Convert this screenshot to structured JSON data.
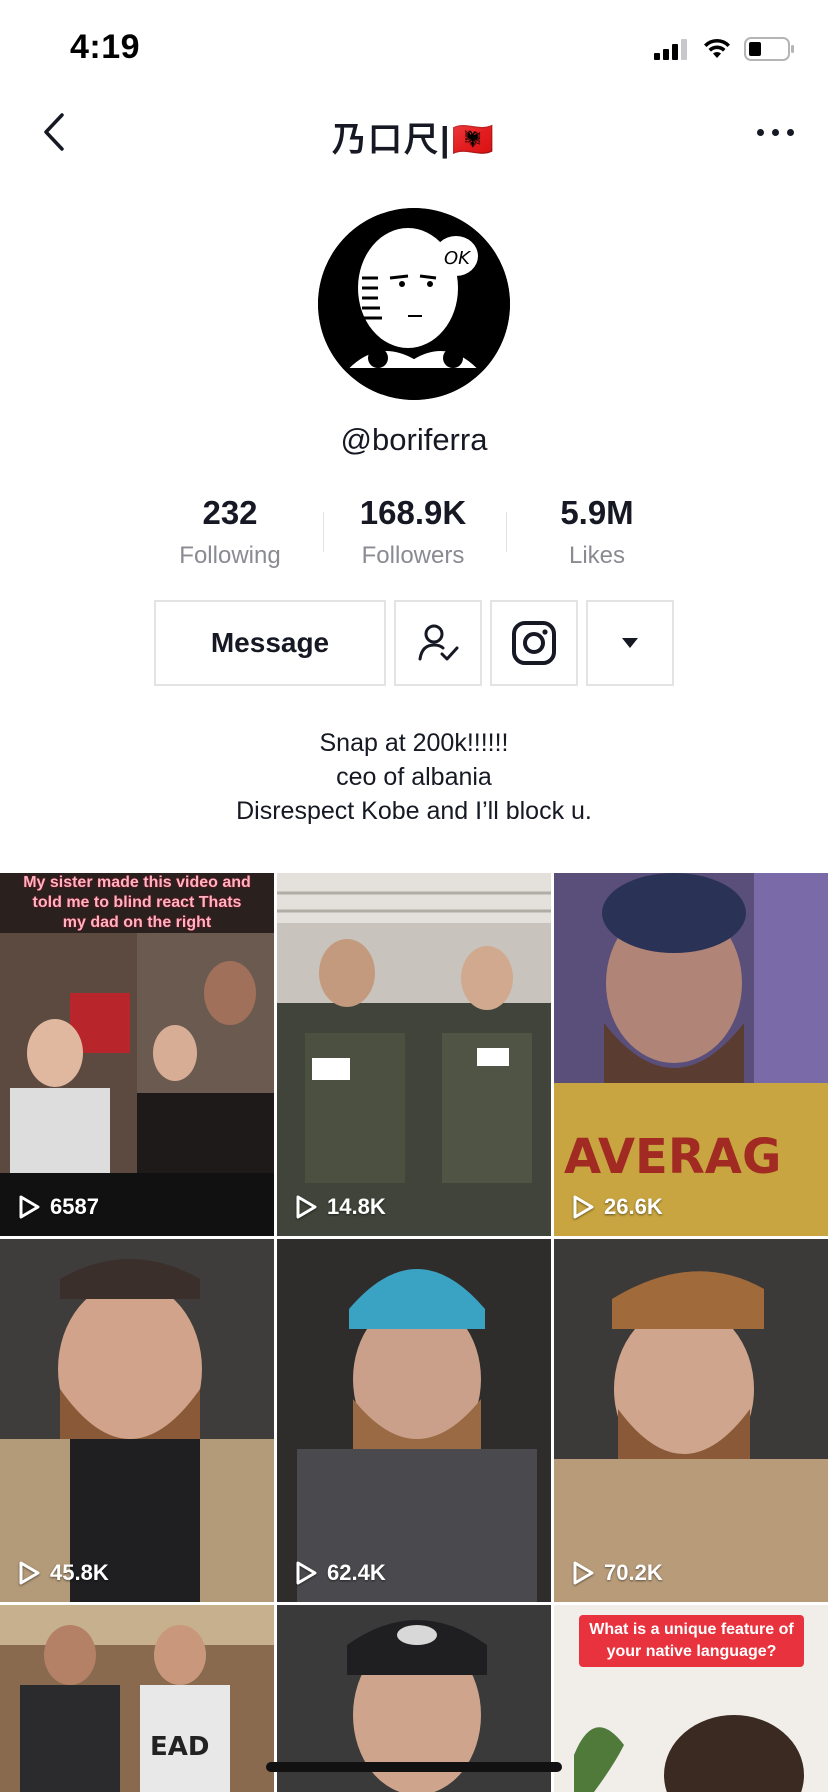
{
  "status_bar": {
    "time": "4:19"
  },
  "nav": {
    "title": "乃口尺|🇦🇱"
  },
  "profile": {
    "username": "@boriferra",
    "stats": [
      {
        "value": "232",
        "label": "Following"
      },
      {
        "value": "168.9K",
        "label": "Followers"
      },
      {
        "value": "5.9M",
        "label": "Likes"
      }
    ]
  },
  "actions": {
    "message_label": "Message",
    "follow_icon": "person-check-icon",
    "instagram_icon": "instagram-icon",
    "more_icon": "caret-down-icon"
  },
  "bio": {
    "lines": [
      "Snap at 200k!!!!!!",
      "ceo of albania",
      "Disrespect Kobe and I’ll block u."
    ]
  },
  "videos": [
    {
      "views": "6587",
      "caption": "My sister made this video and told me to blind react Thats my dad on the right"
    },
    {
      "views": "14.8K"
    },
    {
      "views": "26.6K"
    },
    {
      "views": "45.8K"
    },
    {
      "views": "62.4K"
    },
    {
      "views": "70.2K"
    },
    {
      "views": ""
    },
    {
      "views": ""
    },
    {
      "views": "",
      "caption": "What is a unique feature of your native language?"
    }
  ],
  "colors": {
    "text": "#161823",
    "secondary": "#8a8b91",
    "border": "#e3e3e4"
  }
}
